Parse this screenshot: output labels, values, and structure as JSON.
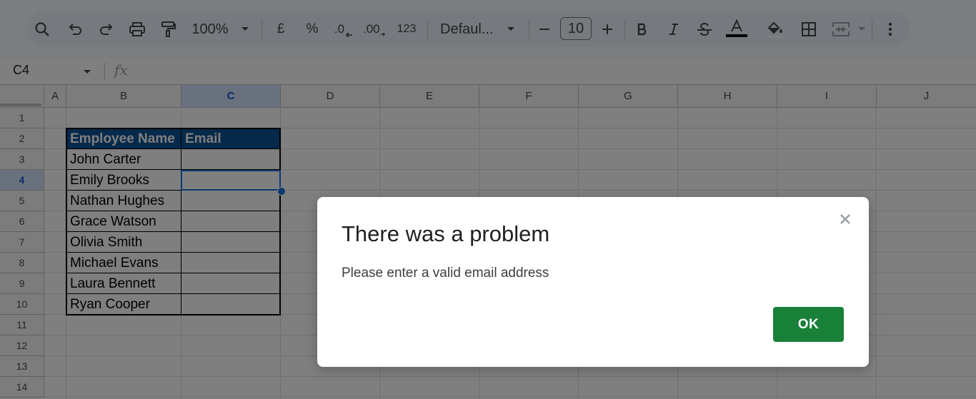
{
  "toolbar": {
    "zoom": "100%",
    "currency_symbol": "£",
    "percent_symbol": "%",
    "decrease_decimal_label": ".0",
    "increase_decimal_label": ".00",
    "number_format_label": "123",
    "font_name": "Defaul...",
    "font_size": "10",
    "icons": [
      "search-icon",
      "undo-icon",
      "redo-icon",
      "print-icon",
      "paint-format-icon",
      "chevron-down-icon",
      "minus-icon",
      "plus-icon",
      "bold-icon",
      "italic-icon",
      "strikethrough-icon",
      "text-color-icon",
      "fill-color-icon",
      "borders-icon",
      "merge-cells-icon",
      "more-vert-icon"
    ]
  },
  "formula_bar": {
    "name_box": "C4",
    "fx_label": "fx",
    "value": ""
  },
  "grid": {
    "columns": [
      "A",
      "B",
      "C",
      "D",
      "E",
      "F",
      "G",
      "H",
      "I",
      "J"
    ],
    "rows": [
      "1",
      "2",
      "3",
      "4",
      "5",
      "6",
      "7",
      "8",
      "9",
      "10",
      "11",
      "12",
      "13",
      "14"
    ],
    "selected_column": "C",
    "selected_row": "4",
    "table": {
      "headers": [
        "Employee Name",
        "Email"
      ],
      "rows": [
        [
          "John Carter",
          ""
        ],
        [
          "Emily Brooks",
          ""
        ],
        [
          "Nathan Hughes",
          ""
        ],
        [
          "Grace Watson",
          ""
        ],
        [
          "Olivia Smith",
          ""
        ],
        [
          "Michael Evans",
          ""
        ],
        [
          "Laura Bennett",
          ""
        ],
        [
          "Ryan Cooper",
          ""
        ]
      ]
    },
    "header_fill_color": "#0b5394",
    "selection_color": "#1a73e8"
  },
  "dialog": {
    "title": "There was a problem",
    "message": "Please enter a valid email address",
    "ok_label": "OK",
    "close_symbol": "×",
    "ok_color": "#188038"
  }
}
